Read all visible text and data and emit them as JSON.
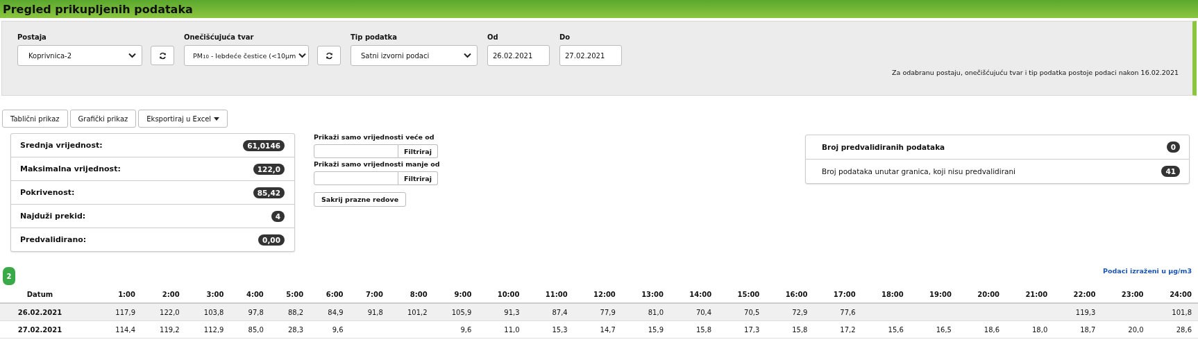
{
  "header": {
    "title": "Pregled prikupljenih podataka"
  },
  "filters": [
    {
      "kind": "select",
      "label": "Postaja",
      "value": "Koprivnica-2",
      "refresh": true
    },
    {
      "kind": "select",
      "label": "Onečišćujuća tvar",
      "value": "PM$_{10}$ - lebdeće čestice (<10µm",
      "refresh": true
    },
    {
      "kind": "select",
      "label": "Tip podatka",
      "value": "Satni izvorni podaci",
      "refresh": false
    },
    {
      "kind": "date",
      "label": "Od",
      "value": "26.02.2021"
    },
    {
      "kind": "date",
      "label": "Do",
      "value": "27.02.2021"
    }
  ],
  "info_note": "Za odabranu postaju, onečišćujuću tvar i tip podatka postoje podaci nakon 16.02.2021",
  "view_buttons": [
    {
      "label": "Tablični prikaz",
      "dropdown": false
    },
    {
      "label": "Grafički prikaz",
      "dropdown": false
    },
    {
      "label": "Eksportiraj u Excel",
      "dropdown": true
    }
  ],
  "stats": [
    {
      "label": "Srednja vrijednost:",
      "value": "61,0146"
    },
    {
      "label": "Maksimalna vrijednost:",
      "value": "122,0"
    },
    {
      "label": "Pokrivenost:",
      "value": "85,42"
    },
    {
      "label": "Najduži prekid:",
      "value": "4"
    },
    {
      "label": "Predvalidirano:",
      "value": "0,00"
    }
  ],
  "value_filters": [
    {
      "label": "Prikaži samo vrijednosti veće od",
      "button": "Filtriraj"
    },
    {
      "label": "Prikaži samo vrijednosti manje od",
      "button": "Filtriraj"
    }
  ],
  "hide_empty_button": "Sakrij prazne redove",
  "validation": [
    {
      "label": "Broj predvalidiranih podataka",
      "value": "0",
      "bold": true
    },
    {
      "label": "Broj podataka unutar granica, koji nisu predvalidirani",
      "value": "41",
      "bold": false
    }
  ],
  "row_count": "2",
  "unit_link": "Podaci izraženi u µg/m3",
  "table": {
    "columns": [
      "Datum",
      "1:00",
      "2:00",
      "3:00",
      "4:00",
      "5:00",
      "6:00",
      "7:00",
      "8:00",
      "9:00",
      "10:00",
      "11:00",
      "12:00",
      "13:00",
      "14:00",
      "15:00",
      "16:00",
      "17:00",
      "18:00",
      "19:00",
      "20:00",
      "21:00",
      "22:00",
      "23:00",
      "24:00"
    ],
    "rows": [
      {
        "selected": true,
        "cells": [
          "26.02.2021",
          "117,9",
          "122,0",
          "103,8",
          "97,8",
          "88,2",
          "84,9",
          "91,8",
          "101,2",
          "105,9",
          "91,3",
          "87,4",
          "77,9",
          "81,0",
          "70,4",
          "70,5",
          "72,9",
          "77,6",
          null,
          null,
          null,
          null,
          "119,3",
          null,
          "101,8"
        ]
      },
      {
        "selected": false,
        "cells": [
          "27.02.2021",
          "114,4",
          "119,2",
          "112,9",
          "85,0",
          "28,3",
          "9,6",
          null,
          null,
          "9,6",
          "11,0",
          "15,3",
          "14,7",
          "15,9",
          "15,8",
          "17,3",
          "15,8",
          "17,2",
          "15,6",
          "16,5",
          "18,6",
          "18,0",
          "18,7",
          "20,0",
          "28,6"
        ]
      }
    ]
  }
}
